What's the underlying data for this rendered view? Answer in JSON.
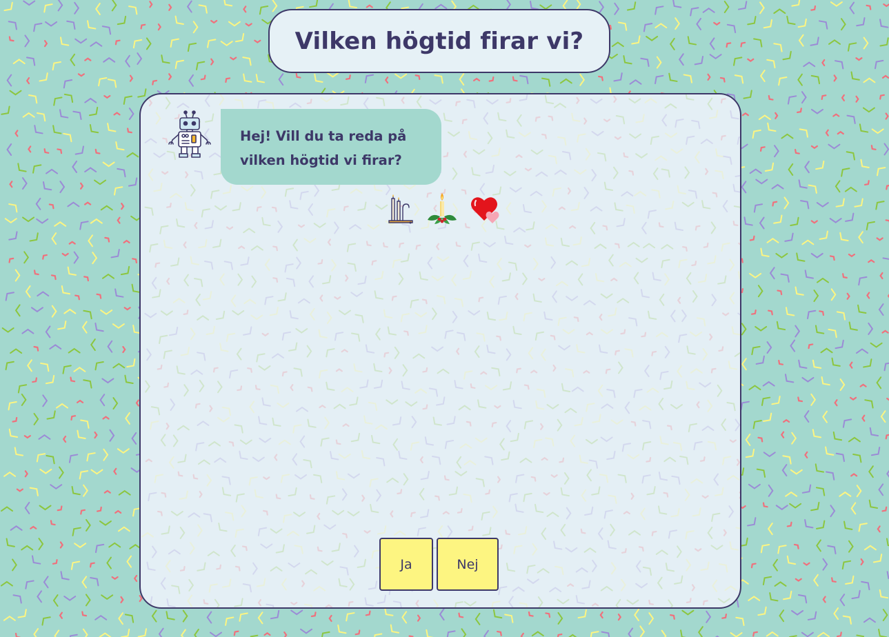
{
  "header": {
    "title": "Vilken högtid firar vi?"
  },
  "chat": {
    "avatar_icon": "robot-icon",
    "message": "Hej! Vill du ta reda på vilken högtid vi firar?"
  },
  "clues": [
    {
      "icon": "candlestick-icon"
    },
    {
      "icon": "christmas-candle-icon"
    },
    {
      "icon": "hearts-icon"
    }
  ],
  "answers": {
    "yes_label": "Ja",
    "no_label": "Nej"
  },
  "colors": {
    "background": "#a3d8ce",
    "panel": "#e4eff5",
    "text": "#3d3868",
    "bubble": "#a3d8ce",
    "button": "#fdf581",
    "confetti": [
      "#fdf581",
      "#9b8bd6",
      "#8cc63f",
      "#f0707c"
    ]
  }
}
